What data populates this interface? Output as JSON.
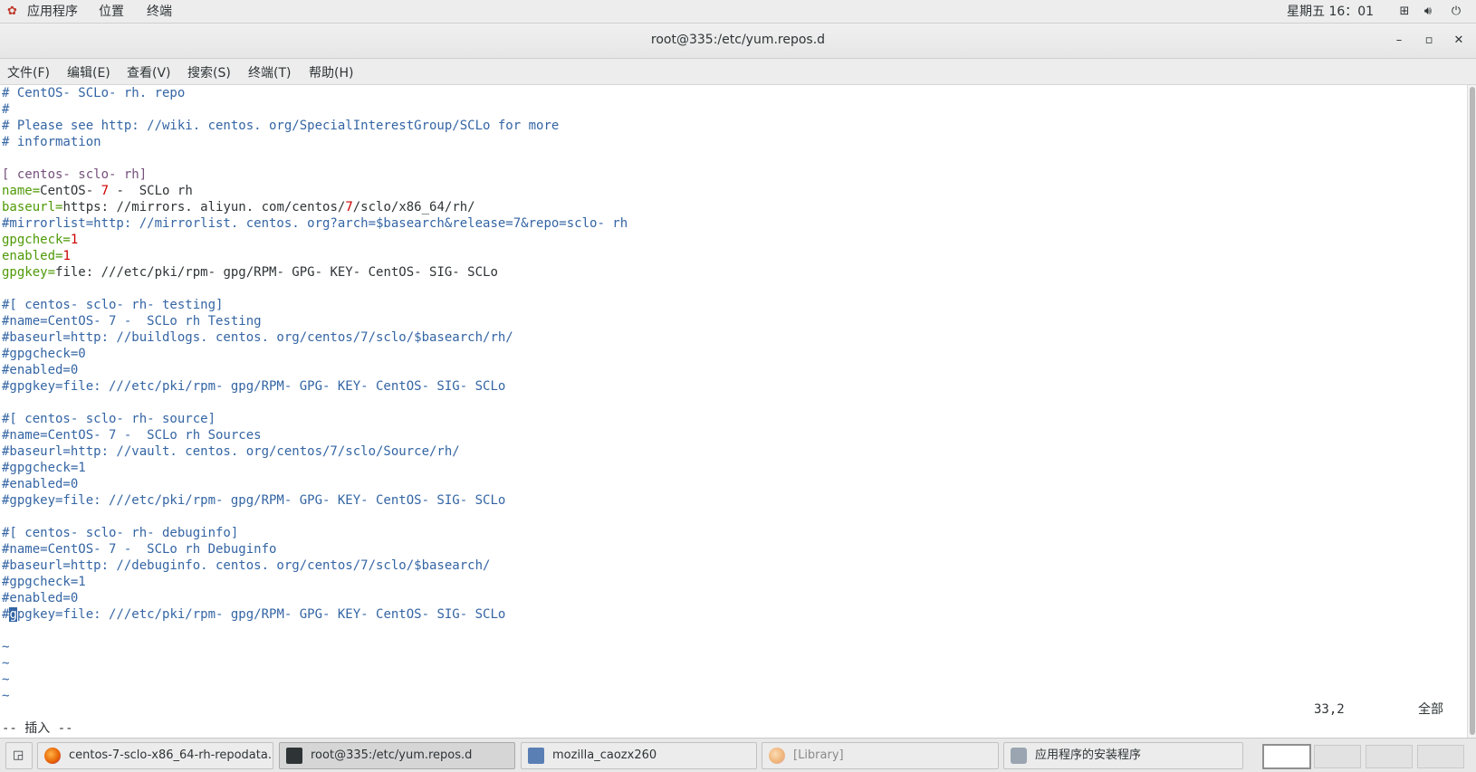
{
  "topbar": {
    "activities": "应用程序",
    "places": "位置",
    "terminal": "终端",
    "clock": "星期五 16：01",
    "icons": [
      "network-icon",
      "volume-icon",
      "power-icon"
    ]
  },
  "window": {
    "title": "root@335:/etc/yum.repos.d",
    "minimize": "–",
    "maximize": "▫",
    "close": "✕"
  },
  "menu": [
    "文件(F)",
    "编辑(E)",
    "查看(V)",
    "搜索(S)",
    "终端(T)",
    "帮助(H)"
  ],
  "editor": {
    "lines": [
      [
        [
          "cm",
          "# CentOS- SCLo- rh. repo"
        ]
      ],
      [
        [
          "cm",
          "#"
        ]
      ],
      [
        [
          "cm",
          "# Please see http: //wiki. centos. org/SpecialInterestGroup/SCLo for more"
        ]
      ],
      [
        [
          "cm",
          "# information"
        ]
      ],
      [],
      [
        [
          "st",
          "[ centos- sclo- rh]"
        ]
      ],
      [
        [
          "id",
          "name="
        ],
        [
          "tx",
          "CentOS- "
        ],
        [
          "nm",
          "7"
        ],
        [
          "tx",
          " -  SCLo rh"
        ]
      ],
      [
        [
          "id",
          "baseurl="
        ],
        [
          "tx",
          "https: //mirrors. aliyun. com/centos/"
        ],
        [
          "nm",
          "7"
        ],
        [
          "tx",
          "/sclo/x86_64/rh/"
        ]
      ],
      [
        [
          "cm",
          "#mirrorlist=http: //mirrorlist. centos. org?arch=$basearch&release=7&repo=sclo- rh"
        ]
      ],
      [
        [
          "id",
          "gpgcheck="
        ],
        [
          "nm",
          "1"
        ]
      ],
      [
        [
          "id",
          "enabled="
        ],
        [
          "nm",
          "1"
        ]
      ],
      [
        [
          "id",
          "gpgkey="
        ],
        [
          "tx",
          "file: ///etc/pki/rpm- gpg/RPM- GPG- KEY- CentOS- SIG- SCLo"
        ]
      ],
      [],
      [
        [
          "cm",
          "#[ centos- sclo- rh- testing]"
        ]
      ],
      [
        [
          "cm",
          "#name=CentOS- 7 -  SCLo rh Testing"
        ]
      ],
      [
        [
          "cm",
          "#baseurl=http: //buildlogs. centos. org/centos/7/sclo/$basearch/rh/"
        ]
      ],
      [
        [
          "cm",
          "#gpgcheck=0"
        ]
      ],
      [
        [
          "cm",
          "#enabled=0"
        ]
      ],
      [
        [
          "cm",
          "#gpgkey=file: ///etc/pki/rpm- gpg/RPM- GPG- KEY- CentOS- SIG- SCLo"
        ]
      ],
      [],
      [
        [
          "cm",
          "#[ centos- sclo- rh- source]"
        ]
      ],
      [
        [
          "cm",
          "#name=CentOS- 7 -  SCLo rh Sources"
        ]
      ],
      [
        [
          "cm",
          "#baseurl=http: //vault. centos. org/centos/7/sclo/Source/rh/"
        ]
      ],
      [
        [
          "cm",
          "#gpgcheck=1"
        ]
      ],
      [
        [
          "cm",
          "#enabled=0"
        ]
      ],
      [
        [
          "cm",
          "#gpgkey=file: ///etc/pki/rpm- gpg/RPM- GPG- KEY- CentOS- SIG- SCLo"
        ]
      ],
      [],
      [
        [
          "cm",
          "#[ centos- sclo- rh- debuginfo]"
        ]
      ],
      [
        [
          "cm",
          "#name=CentOS- 7 -  SCLo rh Debuginfo"
        ]
      ],
      [
        [
          "cm",
          "#baseurl=http: //debuginfo. centos. org/centos/7/sclo/$basearch/"
        ]
      ],
      [
        [
          "cm",
          "#gpgcheck=1"
        ]
      ],
      [
        [
          "cm",
          "#enabled=0"
        ]
      ],
      [
        [
          "cm",
          "#"
        ],
        [
          "cur",
          "g"
        ],
        [
          "cm",
          "pgkey=file: ///etc/pki/rpm- gpg/RPM- GPG- KEY- CentOS- SIG- SCLo"
        ]
      ],
      [],
      [
        [
          "tl",
          "~"
        ]
      ],
      [
        [
          "tl",
          "~"
        ]
      ],
      [
        [
          "tl",
          "~"
        ]
      ],
      [
        [
          "tl",
          "~"
        ]
      ],
      [],
      [
        [
          "tx",
          "-- 插入 --"
        ]
      ]
    ],
    "position": "33,2",
    "scroll": "全部"
  },
  "taskbar": {
    "tasks": [
      {
        "label": "centos-7-sclo-x86_64-rh-repodata...",
        "icon": "firefox-icon"
      },
      {
        "label": "root@335:/etc/yum.repos.d",
        "icon": "terminal-icon"
      },
      {
        "label": "mozilla_caozx260",
        "icon": "file-manager-icon"
      },
      {
        "label": "[Library]",
        "icon": "firefox-icon"
      },
      {
        "label": "应用程序的安装程序",
        "icon": "software-installer-icon"
      }
    ]
  }
}
